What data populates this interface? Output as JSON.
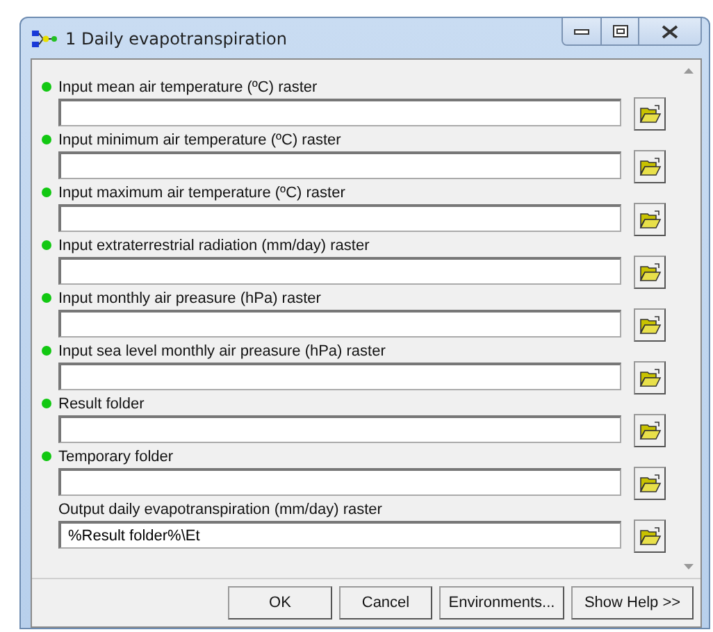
{
  "window": {
    "title": "1 Daily evapotranspiration"
  },
  "parameters": [
    {
      "label": "Input mean air temperature (ºC) raster",
      "required": true
    },
    {
      "label": "Input minimum air temperature (ºC) raster",
      "required": true
    },
    {
      "label": "Input maximum air temperature (ºC) raster",
      "required": true
    },
    {
      "label": "Input extraterrestrial radiation (mm/day) raster",
      "required": true
    },
    {
      "label": "Input monthly air preasure (hPa) raster",
      "required": true
    },
    {
      "label": "Input sea level monthly air preasure (hPa) raster",
      "required": true
    },
    {
      "label": "Result folder",
      "required": true
    },
    {
      "label": "Temporary folder",
      "required": true
    },
    {
      "label": "Output daily evapotranspiration (mm/day) raster",
      "required": false,
      "value": "%Result folder%\\Et"
    }
  ],
  "buttons": [
    "OK",
    "Cancel",
    "Environments...",
    "Show Help >>"
  ]
}
